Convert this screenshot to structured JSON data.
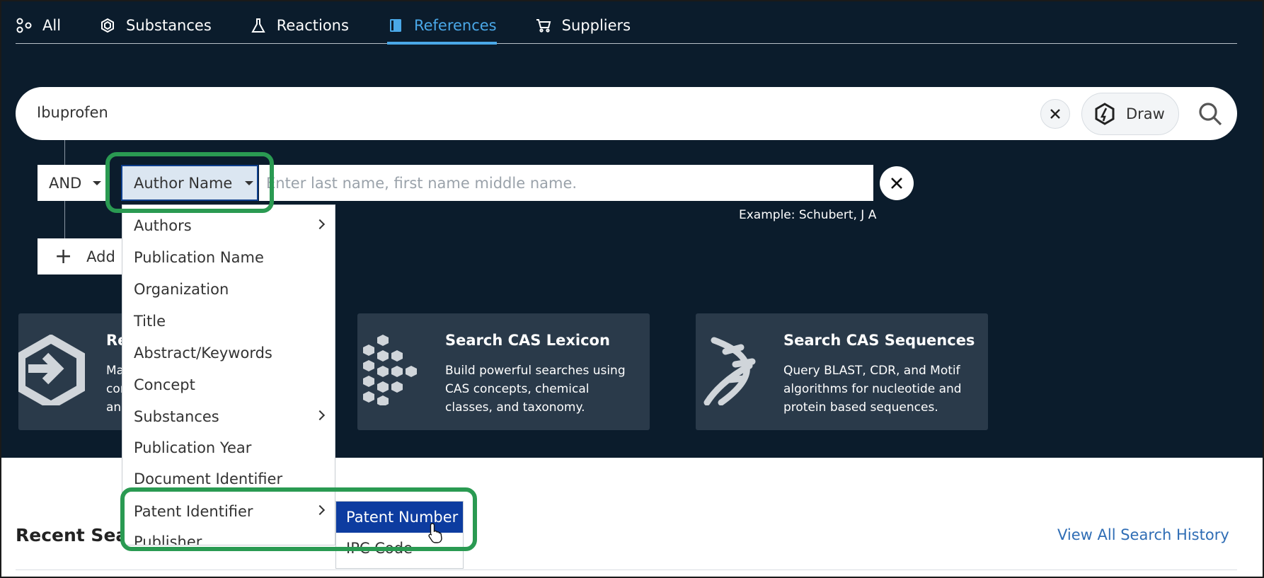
{
  "tabs": [
    {
      "label": "All",
      "icon": "nodes-icon"
    },
    {
      "label": "Substances",
      "icon": "hexagon-icon"
    },
    {
      "label": "Reactions",
      "icon": "flask-icon"
    },
    {
      "label": "References",
      "icon": "book-icon",
      "active": true
    },
    {
      "label": "Suppliers",
      "icon": "cart-icon"
    }
  ],
  "search": {
    "value": "Ibuprofen",
    "draw_label": "Draw"
  },
  "query_row": {
    "operator": "AND",
    "field": "Author Name",
    "placeholder": "Enter last name, first name middle name.",
    "example_label": "Example:",
    "example_value": "Schubert, J A"
  },
  "add_row_label": "Add",
  "field_menu": {
    "items": [
      {
        "label": "Authors",
        "submenu": true
      },
      {
        "label": "Publication Name",
        "submenu": false
      },
      {
        "label": "Organization",
        "submenu": false
      },
      {
        "label": "Title",
        "submenu": false
      },
      {
        "label": "Abstract/Keywords",
        "submenu": false
      },
      {
        "label": "Concept",
        "submenu": false
      },
      {
        "label": "Substances",
        "submenu": true
      },
      {
        "label": "Publication Year",
        "submenu": false
      },
      {
        "label": "Document Identifier",
        "submenu": false
      },
      {
        "label": "Patent Identifier",
        "submenu": true
      },
      {
        "label": "Publisher",
        "submenu": false
      }
    ]
  },
  "patent_submenu": {
    "items": [
      {
        "label": "Patent Number",
        "active": true
      },
      {
        "label": "IPC Code",
        "active": false
      }
    ]
  },
  "cards": [
    {
      "title": "Re",
      "desc": "Ma\ncor\nan",
      "icon": "retro-arrow-icon"
    },
    {
      "title": "Search CAS Lexicon",
      "desc": "Build powerful searches using CAS concepts, chemical classes, and taxonomy.",
      "icon": "lexicon-icon"
    },
    {
      "title": "Search CAS Sequences",
      "desc": "Query BLAST, CDR, and Motif algorithms for nucleotide and protein based sequences.",
      "icon": "dna-icon"
    }
  ],
  "recent": {
    "title": "Recent Sea",
    "view_all": "View All Search History"
  },
  "colors": {
    "hero_bg": "#0b1c2c",
    "accent": "#4aa8e8",
    "highlight": "#2a9a52",
    "menu_active": "#0d3ca0"
  }
}
